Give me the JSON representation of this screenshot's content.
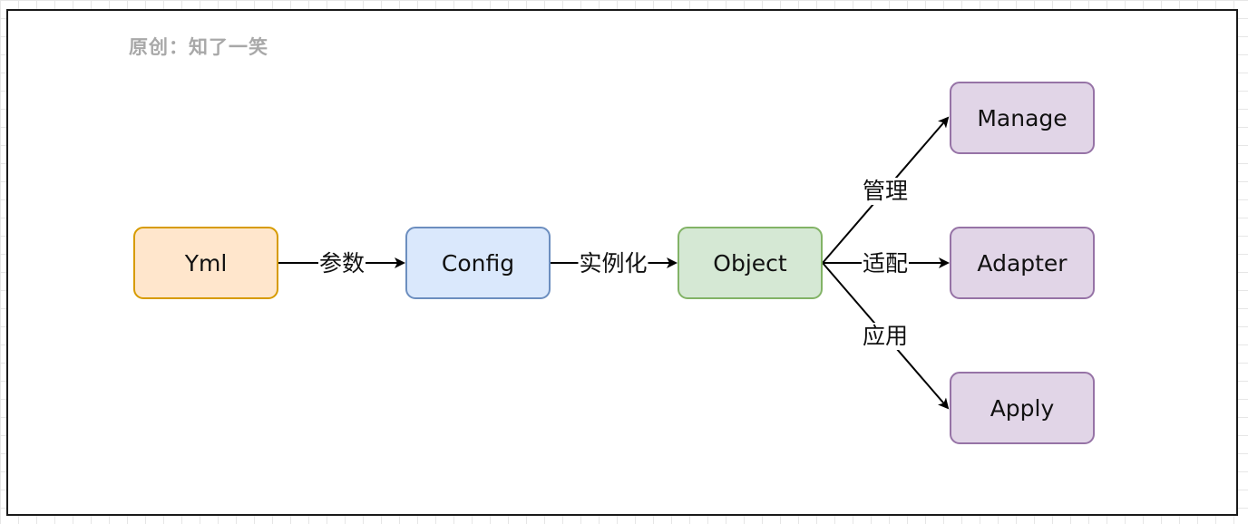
{
  "author": "原创：知了一笑",
  "nodes": {
    "yml": "Yml",
    "config": "Config",
    "object": "Object",
    "manage": "Manage",
    "adapter": "Adapter",
    "apply": "Apply"
  },
  "edges": {
    "yml_config": "参数",
    "config_object": "实例化",
    "object_manage": "管理",
    "object_adapter": "适配",
    "object_apply": "应用"
  },
  "colors": {
    "yml_fill": "#ffe6cc",
    "config_fill": "#dae8fc",
    "object_fill": "#d5e8d4",
    "target_fill": "#e1d5e7",
    "edge": "#000000"
  }
}
